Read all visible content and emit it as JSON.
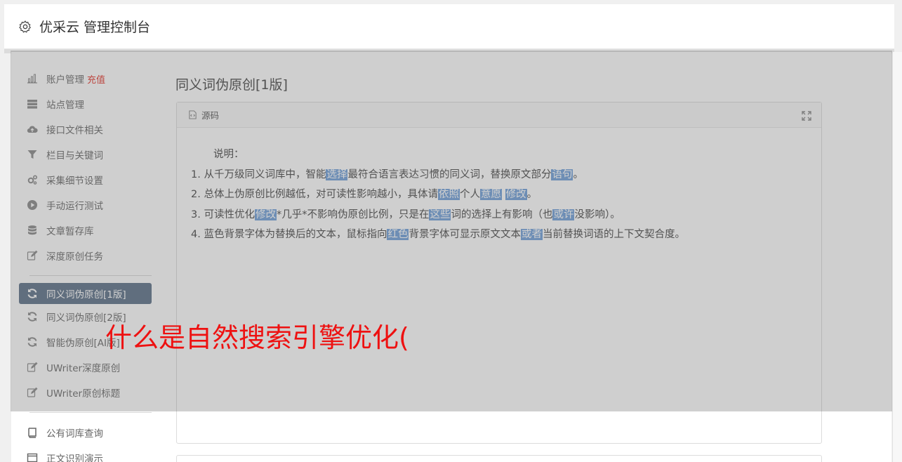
{
  "header": {
    "title": "优采云 管理控制台",
    "icon": "gear-icon"
  },
  "sidebar": {
    "group1": [
      {
        "label": "账户管理",
        "badge": "充值",
        "icon": "bar-chart-icon"
      },
      {
        "label": "站点管理",
        "icon": "server-icon"
      },
      {
        "label": "接口文件相关",
        "icon": "cloud-upload-icon"
      },
      {
        "label": "栏目与关键词",
        "icon": "filter-icon"
      },
      {
        "label": "采集细节设置",
        "icon": "cogs-icon"
      },
      {
        "label": "手动运行测试",
        "icon": "play-circle-icon"
      },
      {
        "label": "文章暂存库",
        "icon": "database-icon"
      },
      {
        "label": "深度原创任务",
        "icon": "edit-icon"
      }
    ],
    "group2": [
      {
        "label": "同义词伪原创[1版]",
        "icon": "refresh-icon",
        "active": true
      },
      {
        "label": "同义词伪原创[2版]",
        "icon": "refresh-icon"
      },
      {
        "label": "智能伪原创[AI版]",
        "icon": "refresh-icon"
      },
      {
        "label": "UWriter深度原创",
        "icon": "edit-icon"
      },
      {
        "label": "UWriter原创标题",
        "icon": "edit-icon"
      }
    ],
    "group3": [
      {
        "label": "公有词库查询",
        "icon": "book-icon"
      },
      {
        "label": "正文识别演示",
        "icon": "window-icon"
      }
    ]
  },
  "main": {
    "title": "同义词伪原创[1版]",
    "panel": {
      "header": "源码",
      "intro": "说明：",
      "lines": [
        [
          {
            "t": "1. 从千万级同义词库中，智能"
          },
          {
            "t": "选择",
            "hl": true
          },
          {
            "t": "最符合语言表达习惯的同义词，替换原文部分"
          },
          {
            "t": "语句",
            "hl": true
          },
          {
            "t": "。"
          }
        ],
        [
          {
            "t": "2. 总体上伪原创比例越低，对可读性影响越小，具体请"
          },
          {
            "t": "依照",
            "hl": true
          },
          {
            "t": "个人"
          },
          {
            "t": "意愿",
            "hl": true
          },
          {
            "t": " "
          },
          {
            "t": "修改",
            "hl": true
          },
          {
            "t": "。"
          }
        ],
        [
          {
            "t": "3. 可读性优化"
          },
          {
            "t": "修改",
            "hl": true
          },
          {
            "t": "*几乎*不影响伪原创比例，只是在"
          },
          {
            "t": "这些",
            "hl": true
          },
          {
            "t": "词的选择上有影响（也"
          },
          {
            "t": "或许",
            "hl": true
          },
          {
            "t": "没影响）。"
          }
        ],
        [
          {
            "t": "4. 蓝色背景字体为替换后的文本，鼠标指向"
          },
          {
            "t": "红色",
            "hl": true
          },
          {
            "t": "背景字体可显示原文文本"
          },
          {
            "t": "或者",
            "hl": true
          },
          {
            "t": "当前替换词语的上下文契合度。"
          }
        ]
      ]
    }
  },
  "overlay": {
    "text": "什么是自然搜索引擎优化("
  },
  "colors": {
    "active_bg": "#5a6f86",
    "highlight": "#6f9fd8",
    "badge": "#e3352b",
    "overlay_text": "#ee1111"
  }
}
